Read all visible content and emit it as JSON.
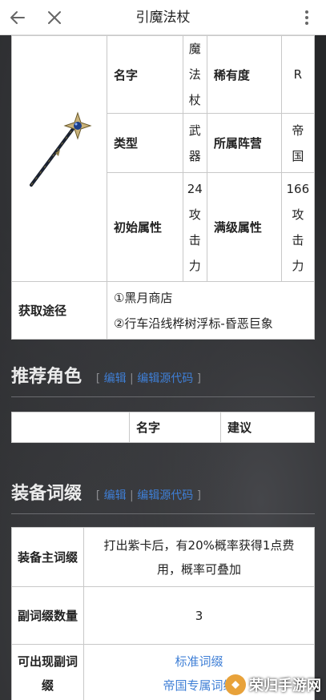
{
  "topbar": {
    "title": "引魔法杖"
  },
  "infobox": {
    "image_alt": "法杖",
    "rows": [
      {
        "label1": "名字",
        "value1": "魔\n法\n杖",
        "label2": "稀有度",
        "value2": "R"
      },
      {
        "label1": "类型",
        "value1": "武\n器",
        "label2": "所属阵营",
        "value2": "帝\n国"
      },
      {
        "label1": "初始属性",
        "value1": "24\n攻\n击\n力",
        "label2": "满级属性",
        "value2": "166\n攻\n击\n力"
      }
    ],
    "acquire_label": "获取途径",
    "acquire_lines": [
      "①黑月商店",
      "②行车沿线桦树浮标-昏恶巨象"
    ]
  },
  "sections": {
    "role": {
      "title": "推荐角色",
      "edit": "编辑",
      "edit_source": "编辑源代码",
      "col_name": "名字",
      "col_advice": "建议"
    },
    "affix": {
      "title": "装备词缀",
      "edit": "编辑",
      "edit_source": "编辑源代码",
      "rows": [
        {
          "label": "装备主词缀",
          "value": "打出紫卡后，有20%概率获得1点费用，概率可叠加"
        },
        {
          "label": "副词缀数量",
          "value": "3"
        },
        {
          "label": "可出现副词缀",
          "links": [
            "标准词缀",
            "帝国专属词缀"
          ]
        }
      ]
    }
  },
  "watermark": {
    "text": "荣归手游网"
  },
  "colors": {
    "link": "#3f7fd6",
    "background": "#262729"
  }
}
